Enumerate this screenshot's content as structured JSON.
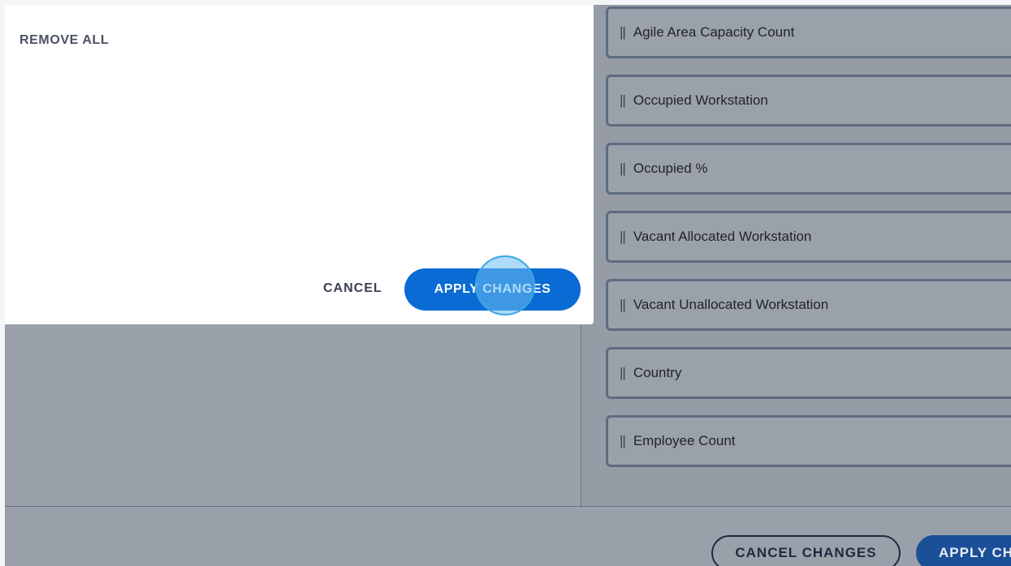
{
  "popover": {
    "remove_all": "REMOVE ALL",
    "cancel": "CANCEL",
    "apply": "APPLY CHANGES"
  },
  "fields": [
    {
      "label": "Agile Area Capacity Count"
    },
    {
      "label": "Occupied Workstation"
    },
    {
      "label": "Occupied %"
    },
    {
      "label": "Vacant Allocated Workstation"
    },
    {
      "label": "Vacant Unallocated Workstation"
    },
    {
      "label": "Country"
    },
    {
      "label": "Employee Count"
    }
  ],
  "drag_handle": "||",
  "footer": {
    "cancel_changes": "CANCEL CHANGES",
    "apply_changes": "APPLY CHANGES"
  },
  "colors": {
    "primary": "#0a6bd4",
    "overlay": "#9aa0a9",
    "click_indicator": "#6cbef0"
  }
}
